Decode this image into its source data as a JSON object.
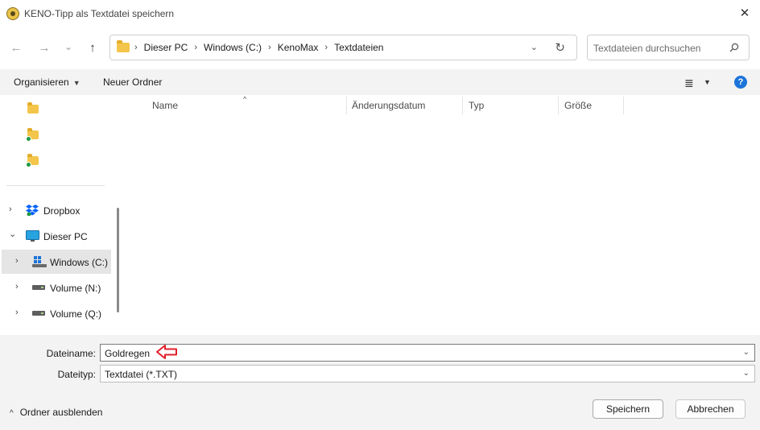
{
  "window": {
    "title": "KENO-Tipp als Textdatei speichern",
    "close_symbol": "✕"
  },
  "navigation": {
    "back_symbol": "←",
    "forward_symbol": "→",
    "recent_symbol": "⌄",
    "up_symbol": "↑",
    "breadcrumb": [
      "Dieser PC",
      "Windows (C:)",
      "KenoMax",
      "Textdateien"
    ],
    "breadcrumb_separator": "›",
    "dropdown_symbol": "⌄",
    "refresh_symbol": "↻",
    "search_placeholder": "Textdateien durchsuchen"
  },
  "toolbar": {
    "organize_label": "Organisieren",
    "organize_caret": "▼",
    "new_folder_label": "Neuer Ordner",
    "view_symbol": "≣",
    "view_caret": "▼",
    "help_symbol": "?"
  },
  "nav_pane": {
    "chevron_right": "›",
    "chevron_down": "⌄",
    "items": [
      {
        "label": "Dropbox"
      },
      {
        "label": "Dieser PC"
      },
      {
        "label": "Windows (C:)"
      },
      {
        "label": "Volume (N:)"
      },
      {
        "label": "Volume (Q:)"
      }
    ]
  },
  "file_list": {
    "sort_symbol": "^",
    "columns": [
      "Name",
      "Änderungsdatum",
      "Typ",
      "Größe"
    ]
  },
  "form": {
    "filename_label": "Dateiname:",
    "filename_value": "Goldregen",
    "filetype_label": "Dateityp:",
    "filetype_value": "Textdatei (*.TXT)",
    "dropdown_symbol": "⌄"
  },
  "footer": {
    "hide_folders_caret": "^",
    "hide_folders_label": "Ordner ausblenden",
    "save_label": "Speichern",
    "cancel_label": "Abbrechen"
  },
  "colors": {
    "accent": "#1d74d8",
    "folder": "#f3c54a",
    "annotation_arrow": "#e0202a"
  }
}
